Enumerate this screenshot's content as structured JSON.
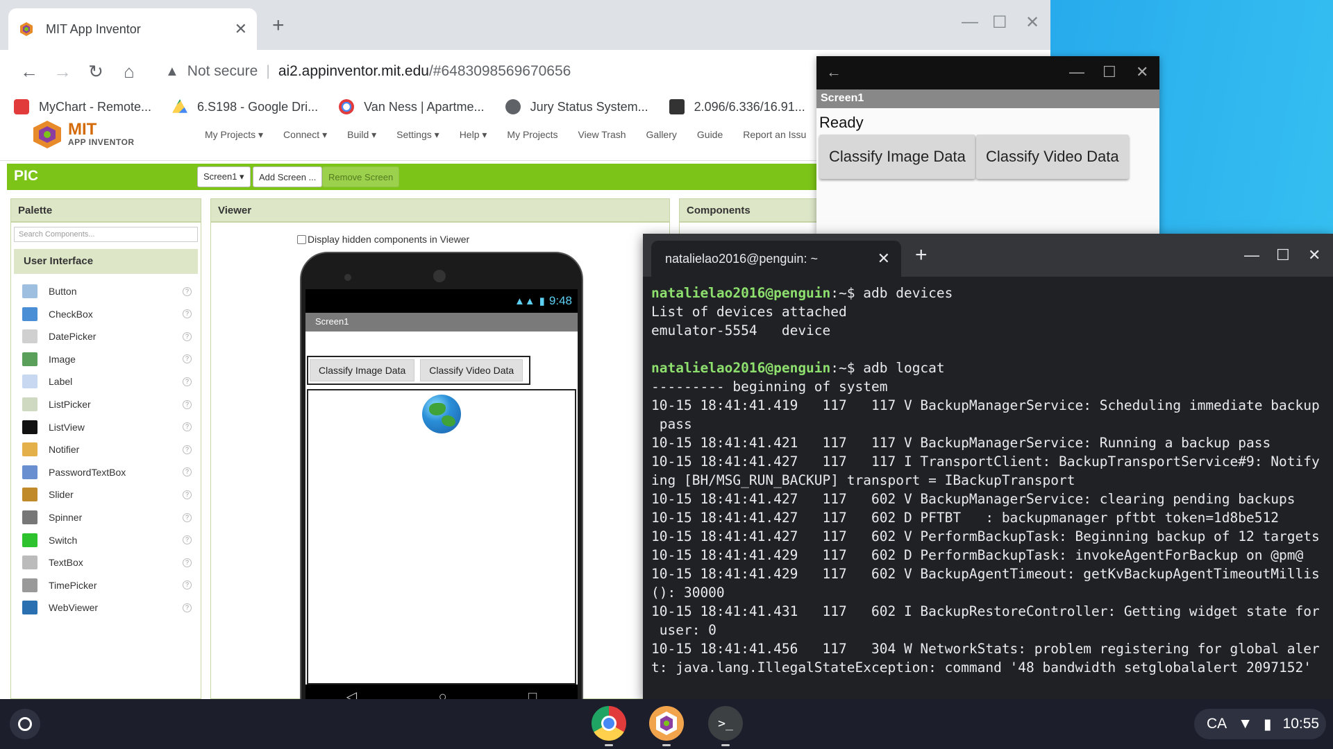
{
  "chrome": {
    "tab_title": "MIT App Inventor",
    "tab_close": "✕",
    "new_tab": "+",
    "url_warning": "Not secure",
    "url_host": "ai2.appinventor.mit.edu",
    "url_path": "/#6483098569670656",
    "bookmarks": [
      "MyChart - Remote...",
      "6.S198 - Google Dri...",
      "Van Ness | Apartme...",
      "Jury Status System...",
      "2.096/6.336/16.91..."
    ]
  },
  "appinventor": {
    "logo_mit": "MIT",
    "logo_sub": "APP INVENTOR",
    "menu": [
      "My Projects ▾",
      "Connect ▾",
      "Build ▾",
      "Settings ▾",
      "Help ▾",
      "My Projects",
      "View Trash",
      "Gallery",
      "Guide",
      "Report an Issu"
    ],
    "project_name": "PIC",
    "screen_select": "Screen1 ▾",
    "add_screen": "Add Screen ...",
    "remove_screen": "Remove Screen",
    "palette_title": "Palette",
    "search_placeholder": "Search Components...",
    "ui_section": "User Interface",
    "palette_items": [
      "Button",
      "CheckBox",
      "DatePicker",
      "Image",
      "Label",
      "ListPicker",
      "ListView",
      "Notifier",
      "PasswordTextBox",
      "Slider",
      "Spinner",
      "Switch",
      "TextBox",
      "TimePicker",
      "WebViewer"
    ],
    "help_glyph": "?",
    "viewer_title": "Viewer",
    "display_hidden": "Display hidden components in Viewer",
    "phone_time": "9:48",
    "phone_screen_title": "Screen1",
    "phone_buttons": [
      "Classify Image Data",
      "Classify Video Data"
    ],
    "components_title": "Components"
  },
  "emulator": {
    "screen_title": "Screen1",
    "status": "Ready",
    "buttons": [
      "Classify Image Data",
      "Classify Video Data"
    ]
  },
  "terminal": {
    "tab_title": "natalielao2016@penguin: ~",
    "prompt_user": "natalielao2016@penguin",
    "prompt_suffix": ":~$ ",
    "lines": [
      {
        "prompt": true,
        "cmd": "adb devices"
      },
      {
        "text": "List of devices attached"
      },
      {
        "text": "emulator-5554   device"
      },
      {
        "text": ""
      },
      {
        "prompt": true,
        "cmd": "adb logcat"
      },
      {
        "text": "--------- beginning of system"
      },
      {
        "text": "10-15 18:41:41.419   117   117 V BackupManagerService: Scheduling immediate backup"
      },
      {
        "text": " pass"
      },
      {
        "text": "10-15 18:41:41.421   117   117 V BackupManagerService: Running a backup pass"
      },
      {
        "text": "10-15 18:41:41.427   117   117 I TransportClient: BackupTransportService#9: Notify"
      },
      {
        "text": "ing [BH/MSG_RUN_BACKUP] transport = IBackupTransport"
      },
      {
        "text": "10-15 18:41:41.427   117   602 V BackupManagerService: clearing pending backups"
      },
      {
        "text": "10-15 18:41:41.427   117   602 D PFTBT   : backupmanager pftbt token=1d8be512"
      },
      {
        "text": "10-15 18:41:41.427   117   602 V PerformBackupTask: Beginning backup of 12 targets"
      },
      {
        "text": "10-15 18:41:41.429   117   602 D PerformBackupTask: invokeAgentForBackup on @pm@"
      },
      {
        "text": "10-15 18:41:41.429   117   602 V BackupAgentTimeout: getKvBackupAgentTimeoutMillis"
      },
      {
        "text": "(): 30000"
      },
      {
        "text": "10-15 18:41:41.431   117   602 I BackupRestoreController: Getting widget state for"
      },
      {
        "text": " user: 0"
      },
      {
        "text": "10-15 18:41:41.456   117   304 W NetworkStats: problem registering for global aler"
      },
      {
        "text": "t: java.lang.IllegalStateException: command '48 bandwidth setglobalalert 2097152'"
      }
    ]
  },
  "shelf": {
    "locale": "CA",
    "time": "10:55",
    "terminal_glyph": ">_"
  },
  "icons": {
    "back": "←",
    "forward": "→",
    "reload": "↻",
    "home": "⌂",
    "warning": "▲",
    "minimize": "—",
    "maximize": "☐",
    "close": "✕"
  }
}
